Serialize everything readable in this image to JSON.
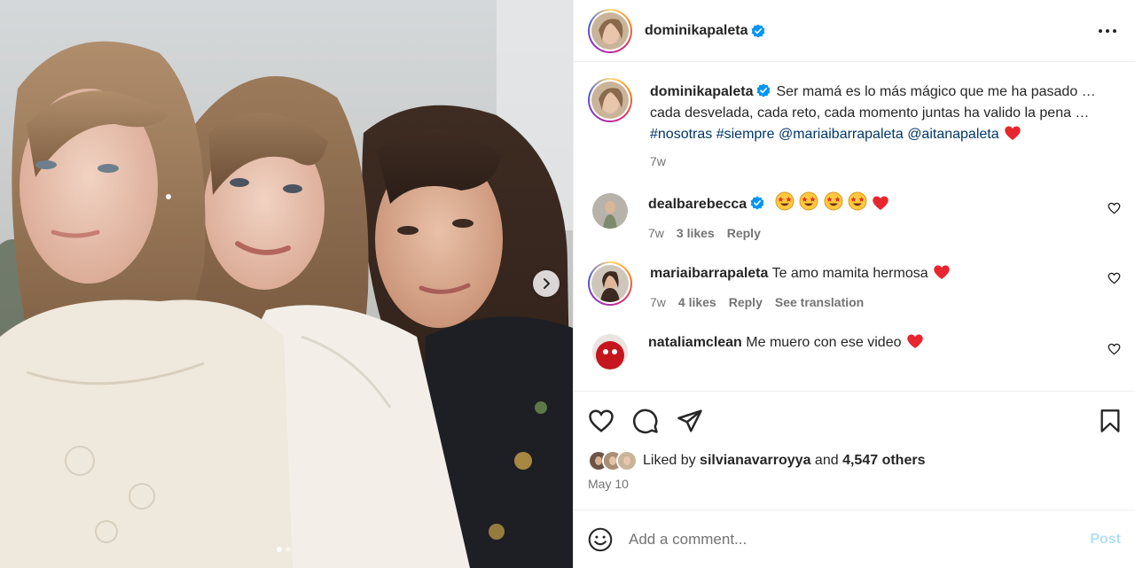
{
  "post": {
    "author": "dominikapaleta",
    "caption_parts": [
      "Ser mamá es lo más mágico que me ha pasado … cada desvelada, cada reto, cada momento juntas ha valido la pena … ",
      "#nosotras",
      " ",
      "#siempre",
      " ",
      "@mariaibarrapaleta",
      " ",
      "@aitanapaleta"
    ],
    "caption_time": "7w",
    "likes_text_prefix": "Liked by ",
    "liked_by": "silvianavarroyya",
    "likes_text_mid": " and ",
    "likes_others": "4,547 others",
    "date": "May 10"
  },
  "comments": [
    {
      "username": "dealbarebecca",
      "verified": true,
      "text": "",
      "emojis": [
        "star-struck",
        "star-struck",
        "star-struck",
        "star-struck",
        "red-heart"
      ],
      "time": "7w",
      "likes": "3 likes",
      "reply": "Reply",
      "translation": ""
    },
    {
      "username": "mariaibarrapaleta",
      "verified": false,
      "text": "Te amo mamita hermosa",
      "emojis": [
        "red-heart"
      ],
      "time": "7w",
      "likes": "4 likes",
      "reply": "Reply",
      "translation": "See translation"
    },
    {
      "username": "nataliamclean",
      "verified": false,
      "text": "Me muero con ese video",
      "emojis": [
        "red-heart"
      ],
      "time": "",
      "likes": "",
      "reply": "",
      "translation": ""
    }
  ],
  "composer": {
    "placeholder": "Add a comment...",
    "post_label": "Post"
  },
  "carousel": {
    "slide_count": 2,
    "active_index": 0
  },
  "colors": {
    "link": "#00376b",
    "verified": "#0095f6",
    "heart": "#ed4956",
    "post_disabled": "#b2dffc"
  }
}
